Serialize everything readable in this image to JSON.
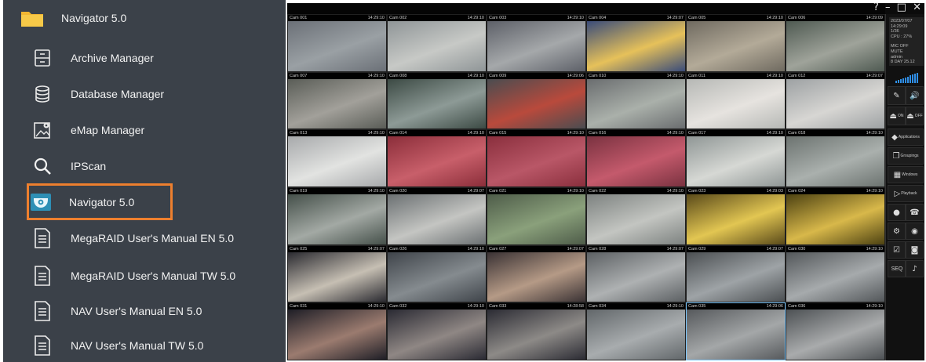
{
  "menu": {
    "header": {
      "label": "Navigator 5.0",
      "icon": "folder-icon"
    },
    "items": [
      {
        "label": "Archive Manager",
        "icon": "archive-cabinet-icon"
      },
      {
        "label": "Database Manager",
        "icon": "database-icon"
      },
      {
        "label": "eMap Manager",
        "icon": "map-pin-icon"
      },
      {
        "label": "IPScan",
        "icon": "magnifier-icon"
      },
      {
        "label": "Navigator 5.0",
        "icon": "camera-dome-icon",
        "highlighted": true
      },
      {
        "label": "MegaRAID User's Manual EN 5.0",
        "icon": "document-icon"
      },
      {
        "label": "MegaRAID User's Manual TW 5.0",
        "icon": "document-icon"
      },
      {
        "label": "NAV User's Manual EN 5.0",
        "icon": "document-icon"
      },
      {
        "label": "NAV User's Manual TW 5.0",
        "icon": "document-icon"
      }
    ],
    "highlight_color": "#ee7f2e"
  },
  "nvr": {
    "window_buttons": "? – □ ✕",
    "info": [
      "2023/07/07",
      "14:29:09",
      "1/36",
      "CPU : 27%",
      "",
      "MIC OFF",
      "MUTE",
      "admin",
      "8 DAY 25.12"
    ],
    "side_buttons": [
      {
        "icon": "microphone-icon",
        "label": ""
      },
      {
        "icon": "speaker-icon",
        "label": ""
      },
      {
        "icon": "alarm-on-icon",
        "label": "ON"
      },
      {
        "icon": "alarm-off-icon",
        "label": "OFF"
      },
      {
        "icon": "applications-icon",
        "label": "Applications"
      },
      {
        "icon": "groupings-icon",
        "label": "Groupings"
      },
      {
        "icon": "windows-icon",
        "label": "Windows"
      },
      {
        "icon": "playback-icon",
        "label": "Playback"
      },
      {
        "icon": "user-icon",
        "label": ""
      },
      {
        "icon": "phone-icon",
        "label": ""
      },
      {
        "icon": "settings-icon",
        "label": ""
      },
      {
        "icon": "ptz-camera-icon",
        "label": ""
      },
      {
        "icon": "checklist-icon",
        "label": ""
      },
      {
        "icon": "snapshot-icon",
        "label": ""
      },
      {
        "icon": "",
        "label": "SEQ"
      },
      {
        "icon": "bell-icon",
        "label": ""
      }
    ],
    "cameras": [
      {
        "name": "Cam 001",
        "time": "14:29:10"
      },
      {
        "name": "Cam 002",
        "time": "14:29:10"
      },
      {
        "name": "Cam 003",
        "time": "14:29:10"
      },
      {
        "name": "Cam 004",
        "time": "14:29:07"
      },
      {
        "name": "Cam 005",
        "time": "14:29:10"
      },
      {
        "name": "Cam 006",
        "time": "14:29:09"
      },
      {
        "name": "Cam 007",
        "time": "14:29:10"
      },
      {
        "name": "Cam 008",
        "time": "14:29:10"
      },
      {
        "name": "Cam 009",
        "time": "14:29:06"
      },
      {
        "name": "Cam 010",
        "time": "14:29:10"
      },
      {
        "name": "Cam 011",
        "time": "14:29:10"
      },
      {
        "name": "Cam 012",
        "time": "14:29:07"
      },
      {
        "name": "Cam 013",
        "time": "14:29:10"
      },
      {
        "name": "Cam 014",
        "time": "14:29:10"
      },
      {
        "name": "Cam 015",
        "time": "14:29:10"
      },
      {
        "name": "Cam 016",
        "time": "14:29:10"
      },
      {
        "name": "Cam 017",
        "time": "14:29:10"
      },
      {
        "name": "Cam 018",
        "time": "14:29:10"
      },
      {
        "name": "Cam 019",
        "time": "14:29:10"
      },
      {
        "name": "Cam 020",
        "time": "14:29:07"
      },
      {
        "name": "Cam 021",
        "time": "14:29:10"
      },
      {
        "name": "Cam 022",
        "time": "14:29:10"
      },
      {
        "name": "Cam 023",
        "time": "14:29:03"
      },
      {
        "name": "Cam 024",
        "time": "14:29:10"
      },
      {
        "name": "Cam 025",
        "time": "14:29:07"
      },
      {
        "name": "Cam 026",
        "time": "14:29:10"
      },
      {
        "name": "Cam 027",
        "time": "14:29:07"
      },
      {
        "name": "Cam 028",
        "time": "14:29:07"
      },
      {
        "name": "Cam 029",
        "time": "14:29:07"
      },
      {
        "name": "Cam 030",
        "time": "14:29:10"
      },
      {
        "name": "Cam 031",
        "time": "14:29:10"
      },
      {
        "name": "Cam 032",
        "time": "14:29:10"
      },
      {
        "name": "Cam 033",
        "time": "14:28:58"
      },
      {
        "name": "Cam 034",
        "time": "14:29:10"
      },
      {
        "name": "Cam 035",
        "time": "14:29:06",
        "selected": true
      },
      {
        "name": "Cam 036",
        "time": "14:29:10"
      }
    ],
    "scene_palettes": [
      [
        "#6b7077",
        "#9aa0a4"
      ],
      [
        "#8f9597",
        "#c7c9c6"
      ],
      [
        "#5d6068",
        "#a5a8aa"
      ],
      [
        "#3a4c7a",
        "#e6c15a"
      ],
      [
        "#6f6a60",
        "#b3aa98"
      ],
      [
        "#4f5a52",
        "#9fa39a"
      ],
      [
        "#5a5d57",
        "#a2a09a"
      ],
      [
        "#3c4a44",
        "#8d9a96"
      ],
      [
        "#4a4c50",
        "#b94a3c"
      ],
      [
        "#6a6d6f",
        "#aab0aa"
      ],
      [
        "#b6b8b5",
        "#e6e3df"
      ],
      [
        "#9da1a3",
        "#d7d6d3"
      ],
      [
        "#a7a9ab",
        "#e2e3e1"
      ],
      [
        "#8b2e3a",
        "#c85f6a"
      ],
      [
        "#8a2f3d",
        "#b95767"
      ],
      [
        "#7a3240",
        "#c45a6c"
      ],
      [
        "#8f9695",
        "#d6d8d4"
      ],
      [
        "#6c7370",
        "#aab0ad"
      ],
      [
        "#45504a",
        "#a3a9a4"
      ],
      [
        "#6b7072",
        "#c4c5c2"
      ],
      [
        "#4e5c49",
        "#8aa07b"
      ],
      [
        "#7d8280",
        "#c3c5c1"
      ],
      [
        "#5a4a1a",
        "#e2c652"
      ],
      [
        "#4d4212",
        "#d8b84a"
      ],
      [
        "#2a2a30",
        "#c6bfb3"
      ],
      [
        "#3f444a",
        "#858b8f"
      ],
      [
        "#3a3234",
        "#b59a86"
      ],
      [
        "#5c6063",
        "#aeb1b2"
      ],
      [
        "#4b4f52",
        "#9ea3a6"
      ],
      [
        "#53575a",
        "#a6aaac"
      ],
      [
        "#1e1e26",
        "#9b7b6f"
      ],
      [
        "#2a2a33",
        "#8f8784"
      ],
      [
        "#2b2b33",
        "#8d8a87"
      ],
      [
        "#62676a",
        "#a8acae"
      ],
      [
        "#56595c",
        "#a4a7a8"
      ],
      [
        "#4d5154",
        "#a9abac"
      ]
    ]
  }
}
